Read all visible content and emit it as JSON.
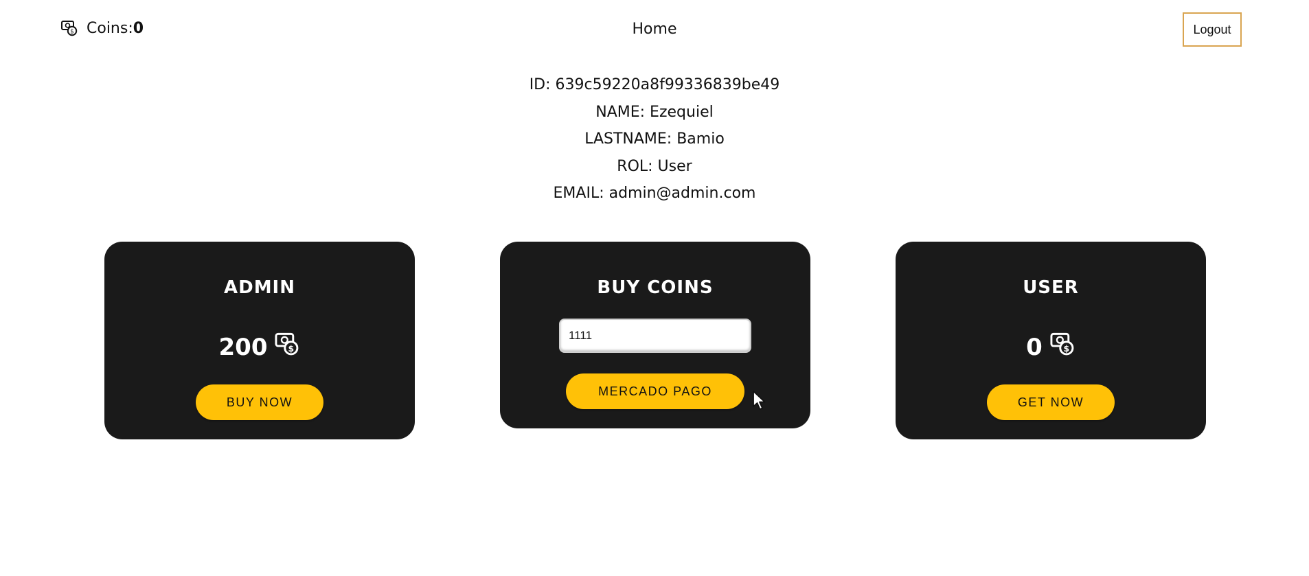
{
  "navbar": {
    "coins_label": "Coins:",
    "coins_value": "0",
    "home_label": "Home",
    "logout_label": "Logout"
  },
  "profile": {
    "id": "ID: 639c59220a8f99336839be49",
    "name": "NAME: Ezequiel",
    "lastname": "LASTNAME: Bamio",
    "rol": "ROL: User",
    "email": "EMAIL: admin@admin.com"
  },
  "cards": {
    "admin": {
      "title": "ADMIN",
      "amount": "200",
      "button": "BUY NOW"
    },
    "buy": {
      "title": "BUY COINS",
      "input_value": "1111",
      "button": "MERCADO PAGO"
    },
    "user": {
      "title": "USER",
      "amount": "0",
      "button": "GET NOW"
    }
  },
  "colors": {
    "card_bg": "#1a1a1a",
    "button_yellow": "#ffc107",
    "logout_border": "#d9a450"
  },
  "icons": {
    "coins": "money-coin-icon"
  }
}
